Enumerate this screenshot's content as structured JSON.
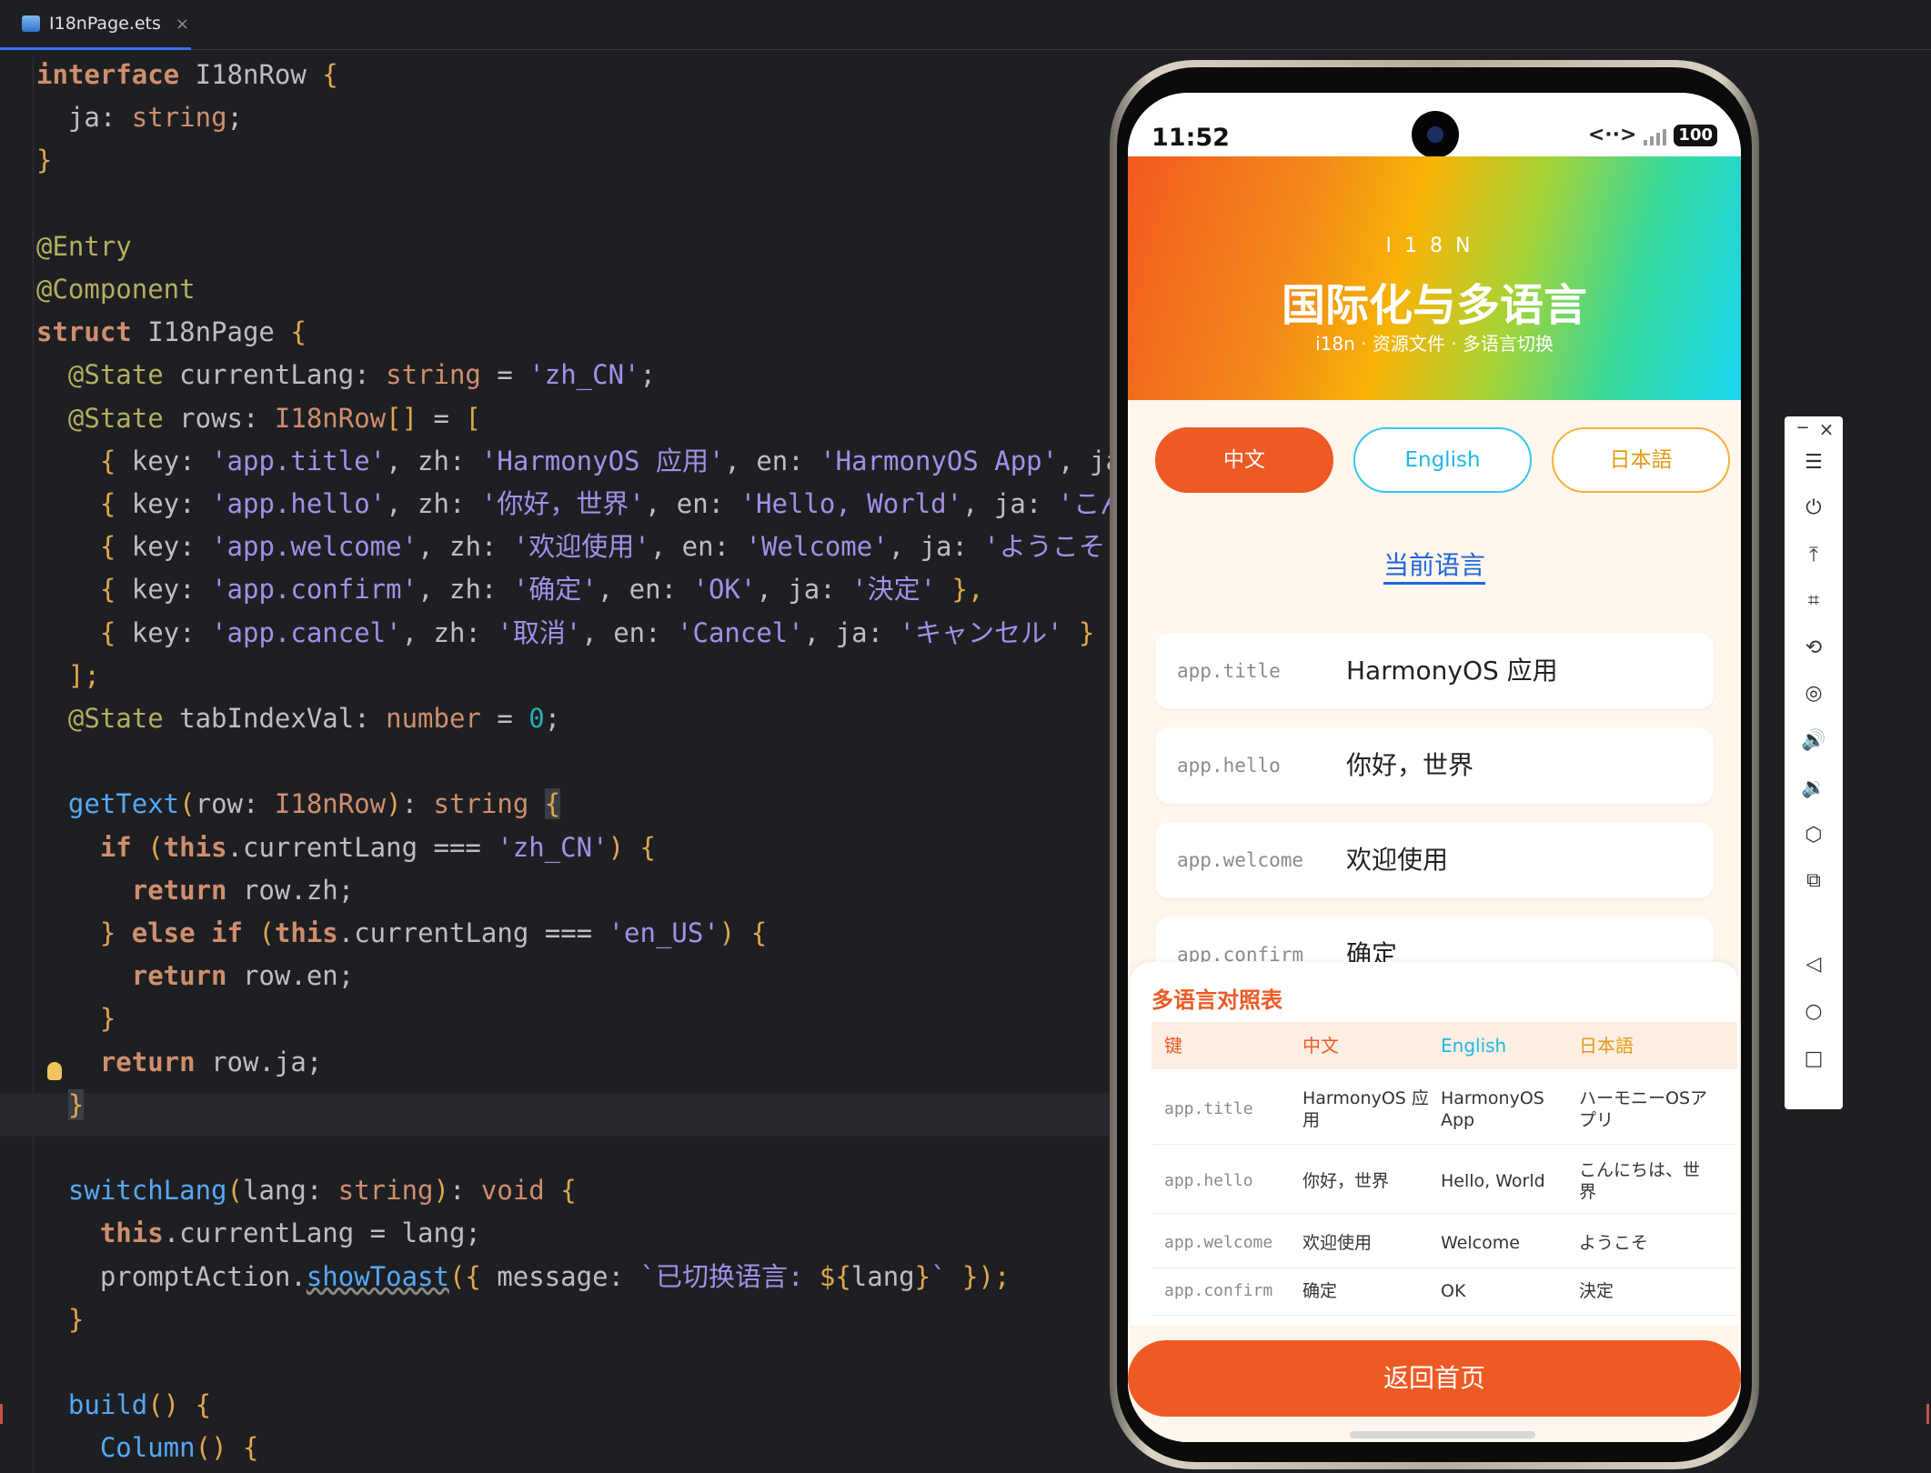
{
  "editor": {
    "tab_filename": "I18nPage.ets",
    "tab_close": "×",
    "lines": [
      [
        {
          "t": "interface ",
          "c": "#cf8e6d",
          "b": true
        },
        {
          "t": "I18nRow ",
          "c": "#bcbec4"
        },
        {
          "t": "{",
          "c": "#e0a84e"
        }
      ],
      [
        {
          "t": "  ja",
          "c": "#bcbec4"
        },
        {
          "t": ": ",
          "c": "#bcbec4"
        },
        {
          "t": "string",
          "c": "#cf8e6d"
        },
        {
          "t": ";",
          "c": "#bcbec4"
        }
      ],
      [
        {
          "t": "}",
          "c": "#e0a84e"
        }
      ],
      [],
      [
        {
          "t": "@Entry",
          "c": "#b3ae60"
        }
      ],
      [
        {
          "t": "@Component",
          "c": "#b3ae60"
        }
      ],
      [
        {
          "t": "struct ",
          "c": "#cf8e6d",
          "b": true
        },
        {
          "t": "I18nPage ",
          "c": "#bcbec4"
        },
        {
          "t": "{",
          "c": "#e0a84e"
        }
      ],
      [
        {
          "t": "  @State ",
          "c": "#b3ae60"
        },
        {
          "t": "currentLang",
          "c": "#bcbec4"
        },
        {
          "t": ": ",
          "c": "#bcbec4"
        },
        {
          "t": "string",
          "c": "#cf8e6d"
        },
        {
          "t": " = ",
          "c": "#bcbec4"
        },
        {
          "t": "'zh_CN'",
          "c": "#a48fe8"
        },
        {
          "t": ";",
          "c": "#bcbec4"
        }
      ],
      [
        {
          "t": "  @State ",
          "c": "#b3ae60"
        },
        {
          "t": "rows",
          "c": "#bcbec4"
        },
        {
          "t": ": ",
          "c": "#bcbec4"
        },
        {
          "t": "I18nRow",
          "c": "#cf8e6d"
        },
        {
          "t": "[]",
          "c": "#e0a84e"
        },
        {
          "t": " = ",
          "c": "#bcbec4"
        },
        {
          "t": "[",
          "c": "#e0a84e"
        }
      ],
      [
        {
          "t": "    { ",
          "c": "#e0a84e"
        },
        {
          "t": "key",
          "c": "#bcbec4"
        },
        {
          "t": ": ",
          "c": "#bcbec4"
        },
        {
          "t": "'app.title'",
          "c": "#a48fe8"
        },
        {
          "t": ", zh: ",
          "c": "#bcbec4"
        },
        {
          "t": "'HarmonyOS 应用'",
          "c": "#a48fe8"
        },
        {
          "t": ", en: ",
          "c": "#bcbec4"
        },
        {
          "t": "'HarmonyOS App'",
          "c": "#a48fe8"
        },
        {
          "t": ", ja:",
          "c": "#bcbec4"
        }
      ],
      [
        {
          "t": "    { ",
          "c": "#e0a84e"
        },
        {
          "t": "key",
          "c": "#bcbec4"
        },
        {
          "t": ": ",
          "c": "#bcbec4"
        },
        {
          "t": "'app.hello'",
          "c": "#a48fe8"
        },
        {
          "t": ", zh: ",
          "c": "#bcbec4"
        },
        {
          "t": "'你好，世界'",
          "c": "#a48fe8"
        },
        {
          "t": ", en: ",
          "c": "#bcbec4"
        },
        {
          "t": "'Hello, World'",
          "c": "#a48fe8"
        },
        {
          "t": ", ja: ",
          "c": "#bcbec4"
        },
        {
          "t": "'こんに",
          "c": "#a48fe8"
        }
      ],
      [
        {
          "t": "    { ",
          "c": "#e0a84e"
        },
        {
          "t": "key",
          "c": "#bcbec4"
        },
        {
          "t": ": ",
          "c": "#bcbec4"
        },
        {
          "t": "'app.welcome'",
          "c": "#a48fe8"
        },
        {
          "t": ", zh: ",
          "c": "#bcbec4"
        },
        {
          "t": "'欢迎使用'",
          "c": "#a48fe8"
        },
        {
          "t": ", en: ",
          "c": "#bcbec4"
        },
        {
          "t": "'Welcome'",
          "c": "#a48fe8"
        },
        {
          "t": ", ja: ",
          "c": "#bcbec4"
        },
        {
          "t": "'ようこそ'",
          "c": "#a48fe8"
        }
      ],
      [
        {
          "t": "    { ",
          "c": "#e0a84e"
        },
        {
          "t": "key",
          "c": "#bcbec4"
        },
        {
          "t": ": ",
          "c": "#bcbec4"
        },
        {
          "t": "'app.confirm'",
          "c": "#a48fe8"
        },
        {
          "t": ", zh: ",
          "c": "#bcbec4"
        },
        {
          "t": "'确定'",
          "c": "#a48fe8"
        },
        {
          "t": ", en: ",
          "c": "#bcbec4"
        },
        {
          "t": "'OK'",
          "c": "#a48fe8"
        },
        {
          "t": ", ja: ",
          "c": "#bcbec4"
        },
        {
          "t": "'決定'",
          "c": "#a48fe8"
        },
        {
          "t": " },",
          "c": "#e0a84e"
        }
      ],
      [
        {
          "t": "    { ",
          "c": "#e0a84e"
        },
        {
          "t": "key",
          "c": "#bcbec4"
        },
        {
          "t": ": ",
          "c": "#bcbec4"
        },
        {
          "t": "'app.cancel'",
          "c": "#a48fe8"
        },
        {
          "t": ", zh: ",
          "c": "#bcbec4"
        },
        {
          "t": "'取消'",
          "c": "#a48fe8"
        },
        {
          "t": ", en: ",
          "c": "#bcbec4"
        },
        {
          "t": "'Cancel'",
          "c": "#a48fe8"
        },
        {
          "t": ", ja: ",
          "c": "#bcbec4"
        },
        {
          "t": "'キャンセル'",
          "c": "#a48fe8"
        },
        {
          "t": " }",
          "c": "#e0a84e"
        }
      ],
      [
        {
          "t": "  ];",
          "c": "#e0a84e"
        }
      ],
      [
        {
          "t": "  @State ",
          "c": "#b3ae60"
        },
        {
          "t": "tabIndexVal",
          "c": "#bcbec4"
        },
        {
          "t": ": ",
          "c": "#bcbec4"
        },
        {
          "t": "number",
          "c": "#cf8e6d"
        },
        {
          "t": " = ",
          "c": "#bcbec4"
        },
        {
          "t": "0",
          "c": "#2aacb8"
        },
        {
          "t": ";",
          "c": "#bcbec4"
        }
      ],
      [],
      [
        {
          "t": "  getText",
          "c": "#56a8f5"
        },
        {
          "t": "(",
          "c": "#e0a84e"
        },
        {
          "t": "row",
          "c": "#bcbec4"
        },
        {
          "t": ": ",
          "c": "#bcbec4"
        },
        {
          "t": "I18nRow",
          "c": "#cf8e6d"
        },
        {
          "t": ")",
          "c": "#e0a84e"
        },
        {
          "t": ": ",
          "c": "#bcbec4"
        },
        {
          "t": "string ",
          "c": "#cf8e6d"
        },
        {
          "t": "{",
          "c": "#e0a84e",
          "k": true
        }
      ],
      [
        {
          "t": "    if ",
          "c": "#cf8e6d",
          "b": true
        },
        {
          "t": "(",
          "c": "#e0a84e"
        },
        {
          "t": "this",
          "c": "#cf8e6d",
          "b": true
        },
        {
          "t": ".currentLang === ",
          "c": "#bcbec4"
        },
        {
          "t": "'zh_CN'",
          "c": "#a48fe8"
        },
        {
          "t": ") {",
          "c": "#e0a84e"
        }
      ],
      [
        {
          "t": "      return ",
          "c": "#cf8e6d",
          "b": true
        },
        {
          "t": "row.zh;",
          "c": "#bcbec4"
        }
      ],
      [
        {
          "t": "    } ",
          "c": "#e0a84e"
        },
        {
          "t": "else if ",
          "c": "#cf8e6d",
          "b": true
        },
        {
          "t": "(",
          "c": "#e0a84e"
        },
        {
          "t": "this",
          "c": "#cf8e6d",
          "b": true
        },
        {
          "t": ".currentLang === ",
          "c": "#bcbec4"
        },
        {
          "t": "'en_US'",
          "c": "#a48fe8"
        },
        {
          "t": ") {",
          "c": "#e0a84e"
        }
      ],
      [
        {
          "t": "      return ",
          "c": "#cf8e6d",
          "b": true
        },
        {
          "t": "row.en;",
          "c": "#bcbec4"
        }
      ],
      [
        {
          "t": "    }",
          "c": "#e0a84e"
        }
      ],
      [
        {
          "t": "    return ",
          "c": "#cf8e6d",
          "b": true
        },
        {
          "t": "row.ja;",
          "c": "#bcbec4"
        }
      ],
      [
        {
          "t": "  ",
          "c": "#bcbec4"
        },
        {
          "t": "}",
          "c": "#e0a84e",
          "k": true
        }
      ],
      [],
      [
        {
          "t": "  switchLang",
          "c": "#56a8f5"
        },
        {
          "t": "(",
          "c": "#e0a84e"
        },
        {
          "t": "lang",
          "c": "#bcbec4"
        },
        {
          "t": ": ",
          "c": "#bcbec4"
        },
        {
          "t": "string",
          "c": "#cf8e6d"
        },
        {
          "t": ")",
          "c": "#e0a84e"
        },
        {
          "t": ": ",
          "c": "#bcbec4"
        },
        {
          "t": "void ",
          "c": "#cf8e6d"
        },
        {
          "t": "{",
          "c": "#e0a84e"
        }
      ],
      [
        {
          "t": "    this",
          "c": "#cf8e6d",
          "b": true
        },
        {
          "t": ".currentLang = lang;",
          "c": "#bcbec4"
        }
      ],
      [
        {
          "t": "    promptAction.",
          "c": "#bcbec4"
        },
        {
          "t": "showToast",
          "c": "#56a8f5",
          "u": true
        },
        {
          "t": "({ ",
          "c": "#e0a84e"
        },
        {
          "t": "message",
          "c": "#bcbec4"
        },
        {
          "t": ": ",
          "c": "#bcbec4"
        },
        {
          "t": "`已切换语言: ",
          "c": "#a48fe8"
        },
        {
          "t": "${",
          "c": "#e0a84e"
        },
        {
          "t": "lang",
          "c": "#bcbec4"
        },
        {
          "t": "}",
          "c": "#e0a84e"
        },
        {
          "t": "`",
          "c": "#a48fe8"
        },
        {
          "t": " });",
          "c": "#e0a84e"
        }
      ],
      [
        {
          "t": "  }",
          "c": "#e0a84e"
        }
      ],
      [],
      [
        {
          "t": "  build",
          "c": "#56a8f5"
        },
        {
          "t": "() {",
          "c": "#e0a84e"
        }
      ],
      [
        {
          "t": "    Column",
          "c": "#56a8f5"
        },
        {
          "t": "() {",
          "c": "#e0a84e"
        }
      ]
    ]
  },
  "phone": {
    "status": {
      "time": "11:52",
      "network": "<··>",
      "battery": "100"
    },
    "hero": {
      "label": "I18N",
      "title": "国际化与多语言",
      "subtitle": "i18n · 资源文件 · 多语言切换"
    },
    "lang_buttons": {
      "zh": "中文",
      "en": "English",
      "ja": "日本語"
    },
    "current_lang_label": "当前语言",
    "rows": [
      {
        "key": "app.title",
        "value": "HarmonyOS 应用"
      },
      {
        "key": "app.hello",
        "value": "你好，世界"
      },
      {
        "key": "app.welcome",
        "value": "欢迎使用"
      },
      {
        "key": "app.confirm",
        "value": "确定"
      }
    ],
    "table": {
      "title": "多语言对照表",
      "headers": [
        "键",
        "中文",
        "English",
        "日本語"
      ],
      "header_colors": [
        "#ee5a24",
        "#ee5a24",
        "#1fb8e6",
        "#e49b14"
      ],
      "rows": [
        [
          "app.title",
          "HarmonyOS 应\n用",
          "HarmonyOS\nApp",
          "ハーモニーOSア\nプリ"
        ],
        [
          "app.hello",
          "你好，世界",
          "Hello, World",
          "こんにちは、世\n界"
        ],
        [
          "app.welcome",
          "欢迎使用",
          "Welcome",
          "ようこそ"
        ],
        [
          "app.confirm",
          "确定",
          "OK",
          "決定"
        ]
      ]
    },
    "back_button": "返回首页"
  },
  "emulator_toolbar": {
    "minimize": "−",
    "close": "×",
    "icons": [
      "menu-icon",
      "power-icon",
      "pin-top-icon",
      "crop-icon",
      "rotate-icon",
      "screenshot-icon",
      "volume-up-icon",
      "volume-down-icon",
      "shake-icon",
      "multi-device-icon",
      "back-icon",
      "home-icon",
      "recents-icon"
    ],
    "glyphs": [
      "☰",
      "⏻",
      "⤒",
      "⌗",
      "⟲",
      "◎",
      "🔊",
      "🔉",
      "⬡",
      "⧉",
      "◁",
      "○",
      "□"
    ]
  },
  "colors": {
    "accent": "#ee5a24",
    "en_accent": "#37c6ee",
    "ja_accent": "#f1b23a",
    "link": "#1f64dd"
  }
}
